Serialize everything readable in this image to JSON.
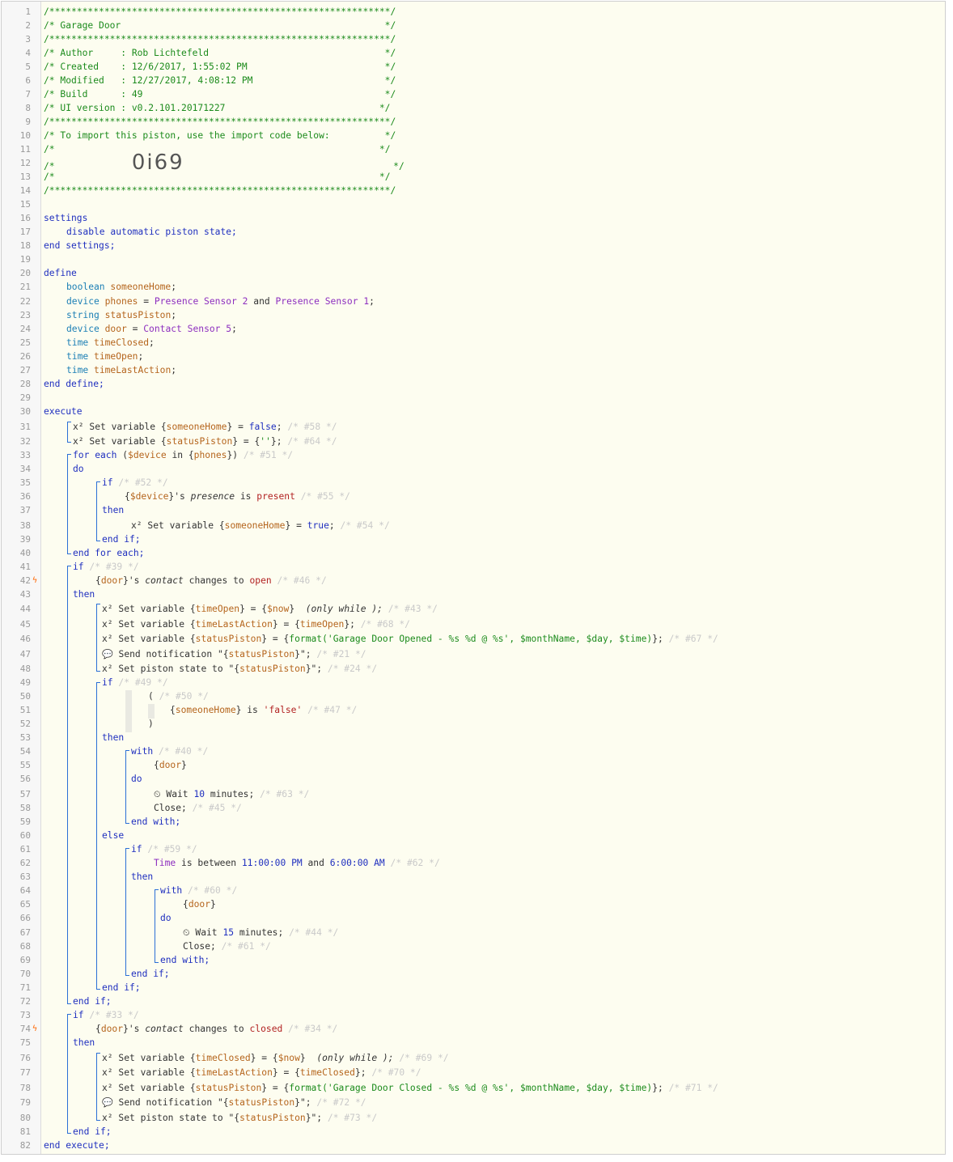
{
  "editor": {
    "gutter_lines": [
      "1",
      "2",
      "3",
      "4",
      "5",
      "6",
      "7",
      "8",
      "9",
      "10",
      "11",
      "12",
      "13",
      "14",
      "15",
      "16",
      "17",
      "18",
      "19",
      "20",
      "21",
      "22",
      "23",
      "24",
      "25",
      "26",
      "27",
      "28",
      "29",
      "30",
      "31",
      "32",
      "33",
      "34",
      "35",
      "36",
      "37",
      "38",
      "39",
      "40",
      "41",
      "42",
      "43",
      "44",
      "45",
      "46",
      "47",
      "48",
      "49",
      "50",
      "51",
      "52",
      "53",
      "54",
      "55",
      "56",
      "57",
      "58",
      "59",
      "60",
      "61",
      "62",
      "63",
      "64",
      "65",
      "66",
      "67",
      "68",
      "69",
      "70",
      "71",
      "72",
      "73",
      "74",
      "75",
      "76",
      "77",
      "78",
      "79",
      "80",
      "81",
      "82"
    ],
    "trigger_marker": "ϟ"
  },
  "header": {
    "border": "/**************************************************************/",
    "title_line": "/* Garage Door                                                */",
    "author_line": "/* Author     : Rob Lichtefeld                                */",
    "created_line": "/* Created    : 12/6/2017, 1:55:02 PM                         */",
    "modified_line": "/* Modified   : 12/27/2017, 4:08:12 PM                        */",
    "build_line": "/* Build      : 49                                            */",
    "uiversion_line": "/* UI version : v0.2.101.20171227                            */",
    "import_line": "/* To import this piston, use the import code below:          */",
    "blank_left": "/*",
    "blank_right": "*/",
    "import_code": "0i69"
  },
  "code": {
    "settings": "settings",
    "disable": "disable automatic piston state;",
    "end_settings": "end settings;",
    "define": "define",
    "boolean": "boolean",
    "device": "device",
    "string": "string",
    "time": "time",
    "someoneHome": "someoneHome",
    "phones": "phones",
    "ps2": "Presence Sensor 2",
    "and": "and",
    "ps1": "Presence Sensor 1",
    "statusPiston": "statusPiston",
    "door": "door",
    "cs5": "Contact Sensor 5",
    "timeClosed": "timeClosed",
    "timeOpen": "timeOpen",
    "timeLastAction": "timeLastAction",
    "end_define": "end define;",
    "execute": "execute",
    "end_execute": "end execute;",
    "x2": "x²",
    "set_variable": "Set variable",
    "set_piston_state": "Set piston state to",
    "send_notification": "Send notification",
    "false": "false",
    "true": "true",
    "empty_str": "''",
    "for_each": "for each",
    "dollar_device": "$device",
    "in": "in",
    "do": "do",
    "if": "if",
    "then": "then",
    "else": "else",
    "end_if": "end if;",
    "end_for_each": "end for each;",
    "with": "with",
    "end_with": "end with;",
    "presence": "presence",
    "is": "is",
    "present": "present",
    "contact": "contact",
    "changes_to": "changes to",
    "open": "open",
    "closed": "closed",
    "now": "$now",
    "only_while": "(only while );",
    "fmt_open": "format('Garage Door Opened - %s %d @ %s', $monthName, $day, $time)",
    "fmt_closed": "format('Garage Door Closed - %s %d @ %s', $monthName, $day, $time)",
    "q_false": "'false'",
    "wait": "Wait",
    "ten": "10",
    "fifteen": "15",
    "minutes": "minutes;",
    "close": "Close;",
    "time_kw": "Time",
    "is_between": "is between",
    "t1": "11:00:00 PM",
    "t2": "6:00:00 AM",
    "clock_icon": "⏲",
    "chat_icon": "💬"
  },
  "comments": {
    "c58": "/* #58 */",
    "c64": "/* #64 */",
    "c51": "/* #51 */",
    "c52": "/* #52 */",
    "c55": "/* #55 */",
    "c54": "/* #54 */",
    "c39": "/* #39 */",
    "c46": "/* #46 */",
    "c43": "/* #43 */",
    "c68": "/* #68 */",
    "c67": "/* #67 */",
    "c21": "/* #21 */",
    "c24": "/* #24 */",
    "c49": "/* #49 */",
    "c50": "/* #50 */",
    "c47": "/* #47 */",
    "c40": "/* #40 */",
    "c63": "/* #63 */",
    "c45": "/* #45 */",
    "c59": "/* #59 */",
    "c62": "/* #62 */",
    "c60": "/* #60 */",
    "c44": "/* #44 */",
    "c61": "/* #61 */",
    "c33": "/* #33 */",
    "c34": "/* #34 */",
    "c69": "/* #69 */",
    "c70": "/* #70 */",
    "c71": "/* #71 */",
    "c72": "/* #72 */",
    "c73": "/* #73 */"
  }
}
